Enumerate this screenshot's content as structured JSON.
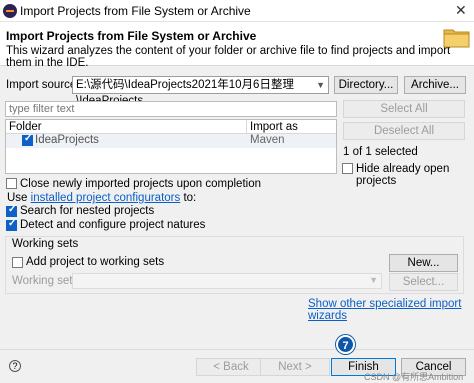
{
  "window": {
    "title": "Import Projects from File System or Archive",
    "close_glyph": "✕"
  },
  "header": {
    "title": "Import Projects from File System or Archive",
    "description": "This wizard analyzes the content of your folder or archive file to find projects and import them in the IDE."
  },
  "source": {
    "label": "Import source:",
    "value": "E:\\源代码\\IdeaProjects2021年10月6日整理\\IdeaProjects",
    "directory_btn": "Directory...",
    "archive_btn": "Archive..."
  },
  "filter": {
    "placeholder": "type filter text"
  },
  "table": {
    "headers": [
      "Folder",
      "Import as"
    ],
    "rows": [
      {
        "folder": "IdeaProjects",
        "import_as": "Maven",
        "checked": true
      }
    ]
  },
  "side": {
    "select_all": "Select All",
    "deselect_all": "Deselect All",
    "selected_count": "1 of 1 selected",
    "hide_open": "Hide already open projects"
  },
  "options": {
    "close_newly": "Close newly imported projects upon completion",
    "use_prefix": "Use ",
    "use_link": "installed project configurators",
    "use_suffix": " to:",
    "search_nested": "Search for nested projects",
    "detect_configure": "Detect and configure project natures"
  },
  "working_sets": {
    "title": "Working sets",
    "add_label": "Add project to working sets",
    "new_btn": "New...",
    "sets_label": "Working sets:",
    "select_btn": "Select..."
  },
  "show_other_link": "Show other specialized import wizards",
  "footer": {
    "help_glyph": "?",
    "back": "< Back",
    "next": "Next >",
    "finish": "Finish",
    "cancel": "Cancel",
    "badge": "7"
  },
  "watermark": "CSDN @有所思Ambition"
}
